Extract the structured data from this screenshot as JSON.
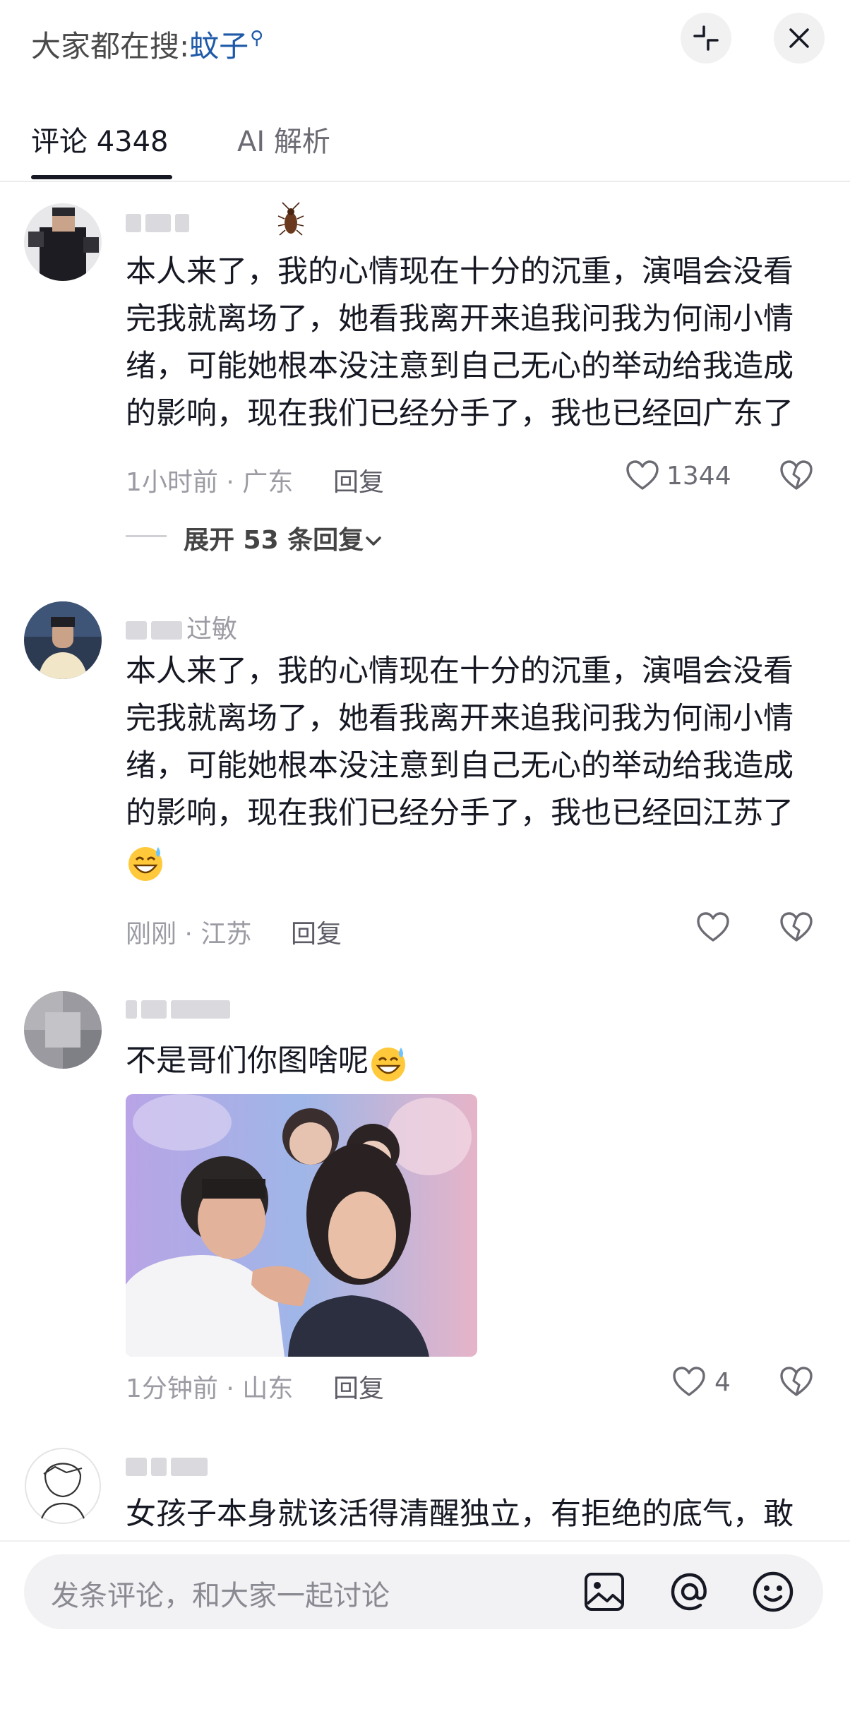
{
  "header": {
    "search_prefix": "大家都在搜:",
    "search_keyword": "蚊子",
    "search_icon": "magnifier-icon",
    "collapse_icon": "collapse-icon",
    "close_icon": "close-icon"
  },
  "tabs": {
    "comments_label": "评论 4348",
    "ai_label": "AI 解析"
  },
  "comments": [
    {
      "username": "",
      "badge_icon": "cockroach-icon",
      "text": "本人来了，我的心情现在十分的沉重，演唱会没看完我就离场了，她看我离开来追我问我为何闹小情绪，可能她根本没注意到自己无心的举动给我造成的影响，现在我们已经分手了，我也已经回广东了",
      "meta": "1小时前 · 广东",
      "reply_label": "回复",
      "likes": "1344",
      "expand_label": "展开 53 条回复"
    },
    {
      "username": "过敏",
      "text": "本人来了，我的心情现在十分的沉重，演唱会没看完我就离场了，她看我离开来追我问我为何闹小情绪，可能她根本没注意到自己无心的举动给我造成的影响，现在我们已经分手了，我也已经回江苏了",
      "emoji": "grinning-sweat-emoji",
      "meta": "刚刚 · 江苏",
      "reply_label": "回复"
    },
    {
      "username": "",
      "text": "不是哥们你图啥呢",
      "emoji": "grinning-sweat-emoji",
      "meta": "1分钟前 · 山东",
      "reply_label": "回复",
      "likes": "4",
      "image_icon": "concert-photo"
    },
    {
      "username": "",
      "text": "女孩子本身就该活得清醒独立，有拒绝的底气，敢"
    }
  ],
  "composer": {
    "placeholder": "发条评论，和大家一起讨论",
    "image_icon": "image-icon",
    "mention_icon": "at-icon",
    "emoji_icon": "smile-icon"
  },
  "colors": {
    "accent_link": "#1e5aa8",
    "text_primary": "#161823",
    "text_secondary": "#9b9ba3"
  }
}
